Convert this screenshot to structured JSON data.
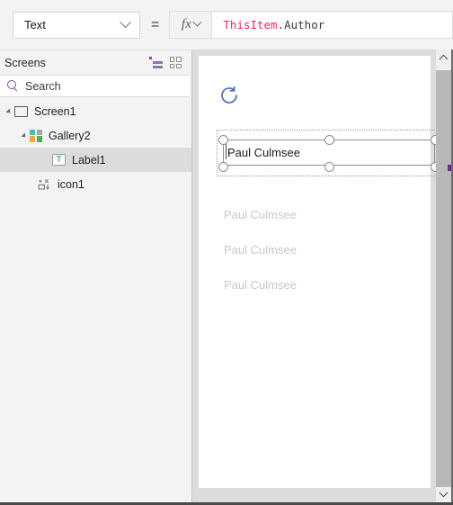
{
  "formula_bar": {
    "property_selected": "Text",
    "property_options": [
      "Text"
    ],
    "equals": "=",
    "fx_label": "fx",
    "formula_object": "ThisItem",
    "formula_property": ".Author",
    "formula_full": "ThisItem.Author"
  },
  "left_panel": {
    "title": "Screens",
    "view_icons": [
      {
        "name": "tree-view-icon"
      },
      {
        "name": "grid-view-icon"
      }
    ],
    "search": {
      "placeholder": "Search",
      "value": ""
    },
    "tree": [
      {
        "label": "Screen1",
        "icon": "screen-icon",
        "depth": 0,
        "expanded": true,
        "selected": false
      },
      {
        "label": "Gallery2",
        "icon": "gallery-icon",
        "depth": 1,
        "expanded": true,
        "selected": false
      },
      {
        "label": "Label1",
        "icon": "label-icon",
        "depth": 2,
        "expanded": null,
        "selected": true
      },
      {
        "label": "icon1",
        "icon": "control-icon",
        "depth": 1,
        "expanded": null,
        "selected": false
      }
    ]
  },
  "canvas": {
    "refresh_icon": "refresh-icon",
    "selected_label_text": "Paul Culmsee",
    "gallery_items": [
      {
        "text": "Paul Culmsee"
      },
      {
        "text": "Paul Culmsee"
      },
      {
        "text": "Paul Culmsee"
      }
    ],
    "scrollbar": {
      "up_arrow": "chevron-up-icon",
      "down_arrow": "chevron-down-icon"
    }
  },
  "colors": {
    "accent_purple": "#7b4f96",
    "formula_token": "#e8276d",
    "refresh_blue": "#4a6fb5",
    "label_teal": "#3dc2b8",
    "gallery_item_text": "#c8c8c8",
    "gallery_icon_colors": [
      "#3dc2b8",
      "#a6a6a6",
      "#f2a93b",
      "#4caf50"
    ]
  }
}
